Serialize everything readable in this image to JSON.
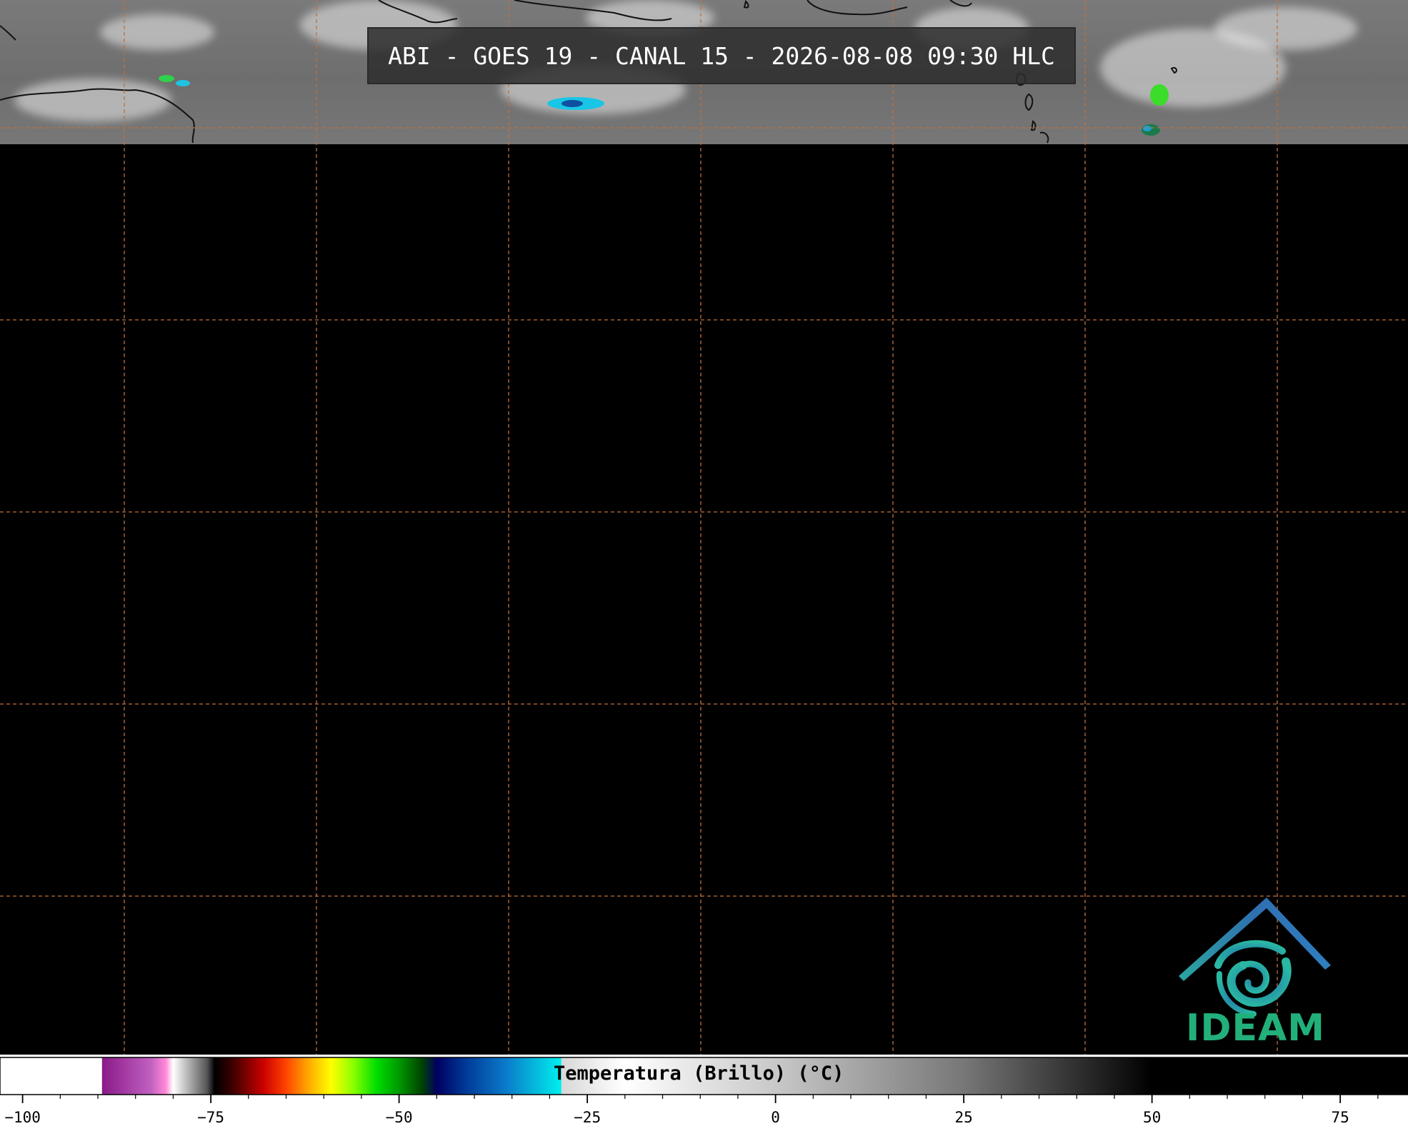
{
  "title": "ABI - GOES 19 - CANAL 15 - 2026-08-08 09:30 HLC",
  "logo": {
    "text": "IDEAM",
    "colors": {
      "roof": "#2f6fb0",
      "swirl": "#27b3a0",
      "text": "#22b07a"
    }
  },
  "colorbar": {
    "label": "Temperatura (Brillo) (°C)",
    "ticks": [
      "−100",
      "−75",
      "−50",
      "−25",
      "0",
      "25",
      "50",
      "75"
    ],
    "range": [
      -103,
      84
    ],
    "colors": {
      "graticule": "#c0703a",
      "coastline": "#111111"
    }
  }
}
